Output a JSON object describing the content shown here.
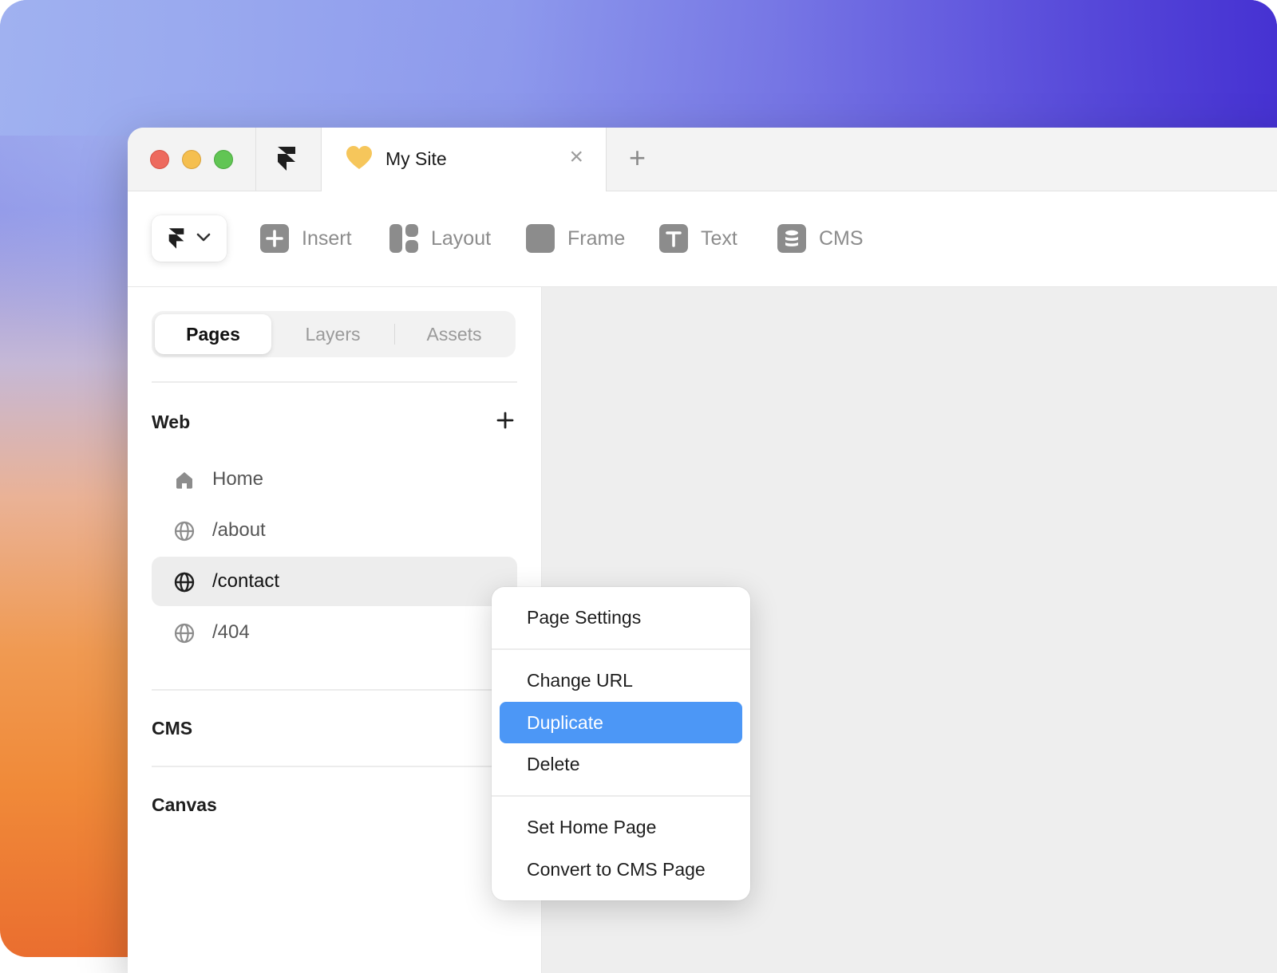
{
  "colors": {
    "accent": "#4c97f6",
    "traffic_red": "#ed6a5e",
    "traffic_yellow": "#f5bf4f",
    "traffic_green": "#61c554",
    "tab_heart": "#f6c65b"
  },
  "titlebar": {
    "logo_icon": "framer-logo-icon",
    "tab": {
      "icon": "heart-icon",
      "title": "My Site",
      "close_glyph": "×"
    },
    "new_tab_glyph": "+"
  },
  "toolbar": {
    "menu_icon": "framer-logo-icon",
    "tools": [
      {
        "label": "Insert",
        "icon": "plus-square-icon"
      },
      {
        "label": "Layout",
        "icon": "layout-icon"
      },
      {
        "label": "Frame",
        "icon": "frame-icon"
      },
      {
        "label": "Text",
        "icon": "text-icon"
      },
      {
        "label": "CMS",
        "icon": "database-icon"
      }
    ]
  },
  "sidebar": {
    "tabs": [
      {
        "label": "Pages",
        "active": true
      },
      {
        "label": "Layers",
        "active": false
      },
      {
        "label": "Assets",
        "active": false
      }
    ],
    "web_section": {
      "title": "Web",
      "pages": [
        {
          "label": "Home",
          "icon": "home-icon",
          "selected": false
        },
        {
          "label": "/about",
          "icon": "globe-icon",
          "selected": false
        },
        {
          "label": "/contact",
          "icon": "globe-icon",
          "selected": true
        },
        {
          "label": "/404",
          "icon": "globe-icon",
          "selected": false
        }
      ]
    },
    "cms_section": {
      "title": "CMS"
    },
    "canvas_section": {
      "title": "Canvas"
    }
  },
  "context_menu": {
    "groups": [
      [
        {
          "label": "Page Settings",
          "highlighted": false
        }
      ],
      [
        {
          "label": "Change URL",
          "highlighted": false
        },
        {
          "label": "Duplicate",
          "highlighted": true
        },
        {
          "label": "Delete",
          "highlighted": false
        }
      ],
      [
        {
          "label": "Set Home Page",
          "highlighted": false
        },
        {
          "label": "Convert to CMS Page",
          "highlighted": false
        }
      ]
    ]
  }
}
